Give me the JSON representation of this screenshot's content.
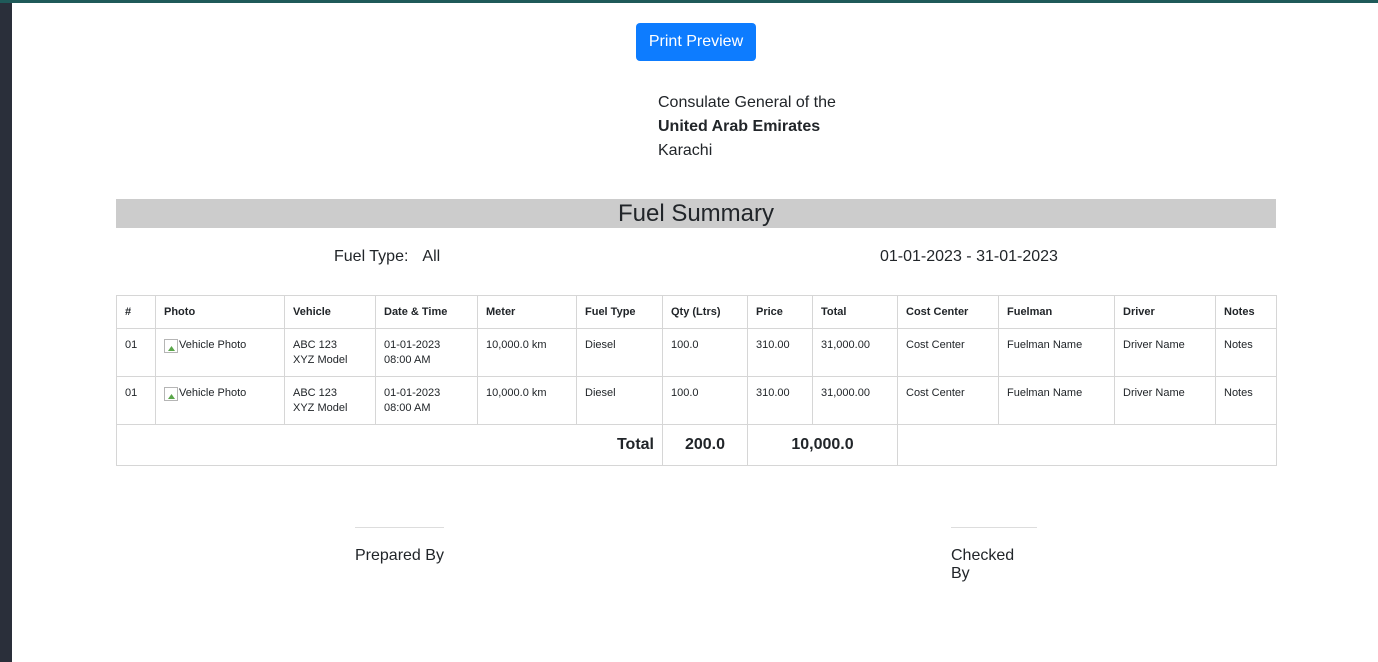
{
  "toolbar": {
    "print_preview_label": "Print Preview"
  },
  "header": {
    "line1": "Consulate General of the",
    "line2": "United Arab Emirates",
    "line3": "Karachi"
  },
  "report": {
    "title": "Fuel Summary",
    "fuel_type_label": "Fuel Type:",
    "fuel_type_value": "All",
    "date_range": "01-01-2023 - 31-01-2023"
  },
  "table": {
    "columns": [
      "#",
      "Photo",
      "Vehicle",
      "Date & Time",
      "Meter",
      "Fuel Type",
      "Qty (Ltrs)",
      "Price",
      "Total",
      "Cost Center",
      "Fuelman",
      "Driver",
      "Notes"
    ],
    "rows": [
      {
        "no": "01",
        "photo_alt": "Vehicle Photo",
        "vehicle_plate": "ABC 123",
        "vehicle_model": "XYZ Model",
        "date": "01-01-2023",
        "time": "08:00 AM",
        "meter": "10,000.0 km",
        "fuel_type": "Diesel",
        "qty": "100.0",
        "price": "310.00",
        "total": "31,000.00",
        "cost_center": "Cost Center",
        "fuelman": "Fuelman Name",
        "driver": "Driver Name",
        "notes": "Notes"
      },
      {
        "no": "01",
        "photo_alt": "Vehicle Photo",
        "vehicle_plate": "ABC 123",
        "vehicle_model": "XYZ Model",
        "date": "01-01-2023",
        "time": "08:00 AM",
        "meter": "10,000.0 km",
        "fuel_type": "Diesel",
        "qty": "100.0",
        "price": "310.00",
        "total": "31,000.00",
        "cost_center": "Cost Center",
        "fuelman": "Fuelman Name",
        "driver": "Driver Name",
        "notes": "Notes"
      }
    ],
    "footer": {
      "label": "Total",
      "qty_total": "200.0",
      "amount_total": "10,000.0"
    }
  },
  "signatures": {
    "prepared_by": "Prepared By",
    "checked_by": "Checked By"
  },
  "colors": {
    "primary_button": "#0d7cff",
    "title_bar": "#cccccc",
    "left_rail": "#2a2f3a",
    "top_rail": "#1f5a59"
  }
}
